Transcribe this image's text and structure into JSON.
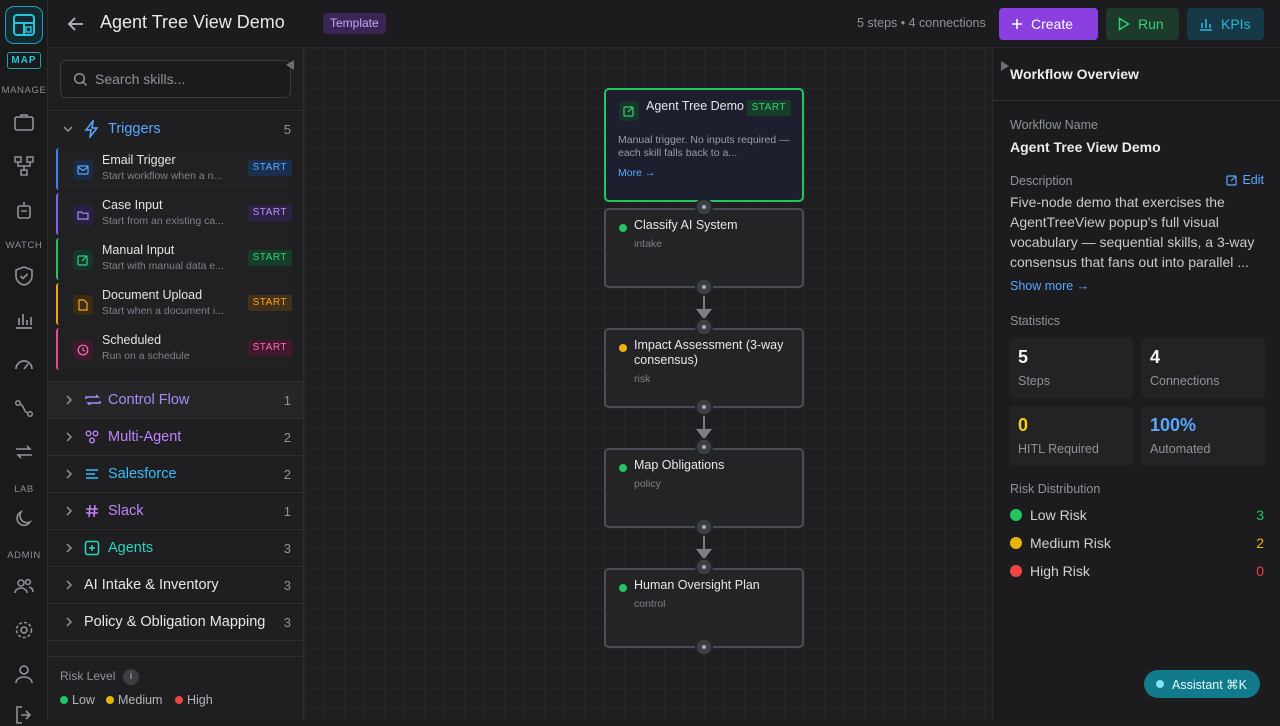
{
  "rail": {
    "badge": "MAP",
    "sections": [
      "MANAGE",
      "WATCH",
      "LAB",
      "ADMIN"
    ]
  },
  "header": {
    "title": "Agent Tree View Demo",
    "badge": "Template",
    "stats": "5 steps • 4 connections",
    "create_label": "Create",
    "run_label": "Run",
    "kpis_label": "KPIs"
  },
  "sidebar": {
    "search_placeholder": "Search skills...",
    "triggers": {
      "label": "Triggers",
      "count": "5",
      "items": [
        {
          "name": "Email Trigger",
          "desc": "Start workflow when a n...",
          "tag": "START",
          "color": "#3b82f6"
        },
        {
          "name": "Case Input",
          "desc": "Start from an existing ca...",
          "tag": "START",
          "color": "#8b5cf6"
        },
        {
          "name": "Manual Input",
          "desc": "Start with manual data e...",
          "tag": "START",
          "color": "#22c55e"
        },
        {
          "name": "Document Upload",
          "desc": "Start when a document i...",
          "tag": "START",
          "color": "#f59e0b"
        },
        {
          "name": "Scheduled",
          "desc": "Run on a schedule",
          "tag": "START",
          "color": "#ec4899"
        }
      ]
    },
    "categories": [
      {
        "label": "Control Flow",
        "count": "1",
        "color": "#a78bfa"
      },
      {
        "label": "Multi-Agent",
        "count": "2",
        "color": "#c084fc"
      },
      {
        "label": "Salesforce",
        "count": "2",
        "color": "#38bdf8"
      },
      {
        "label": "Slack",
        "count": "1",
        "color": "#c084fc"
      },
      {
        "label": "Agents",
        "count": "3",
        "color": "#2dd4bf"
      },
      {
        "label": "AI Intake & Inventory",
        "count": "3",
        "color": "#e5e7eb"
      },
      {
        "label": "Policy & Obligation Mapping",
        "count": "3",
        "color": "#e5e7eb"
      }
    ],
    "risk_level": {
      "title": "Risk Level",
      "info": "i",
      "items": [
        {
          "label": "Low",
          "color": "#22c55e"
        },
        {
          "label": "Medium",
          "color": "#eab308"
        },
        {
          "label": "High",
          "color": "#ef4444"
        }
      ]
    }
  },
  "canvas": {
    "start_node": {
      "name": "Agent Tree Demo",
      "tag": "START",
      "desc": "Manual trigger. No inputs required — each skill falls back to a...",
      "more": "More →"
    },
    "nodes": [
      {
        "name": "Classify AI System",
        "category": "intake",
        "risk_color": "#22c55e"
      },
      {
        "name": "Impact Assessment (3-way consensus)",
        "category": "risk",
        "risk_color": "#eab308"
      },
      {
        "name": "Map Obligations",
        "category": "policy",
        "risk_color": "#22c55e"
      },
      {
        "name": "Human Oversight Plan",
        "category": "control",
        "risk_color": "#22c55e"
      }
    ]
  },
  "panel": {
    "title": "Workflow Overview",
    "name_label": "Workflow Name",
    "name_value": "Agent Tree View Demo",
    "desc_label": "Description",
    "edit_label": "Edit",
    "description": "Five-node demo that exercises the AgentTreeView popup's full visual vocabulary — sequential skills, a 3-way consensus that fans out into parallel ...",
    "show_more": "Show more →",
    "stats_label": "Statistics",
    "stats": [
      {
        "value": "5",
        "label": "Steps",
        "color": "#f3f4f6"
      },
      {
        "value": "4",
        "label": "Connections",
        "color": "#f3f4f6"
      },
      {
        "value": "0",
        "label": "HITL Required",
        "color": "#facc15"
      },
      {
        "value": "100%",
        "label": "Automated",
        "color": "#5aa8ff"
      }
    ],
    "risk_label": "Risk Distribution",
    "risks": [
      {
        "label": "Low Risk",
        "count": "3",
        "color": "#22c55e"
      },
      {
        "label": "Medium Risk",
        "count": "2",
        "color": "#eab308"
      },
      {
        "label": "High Risk",
        "count": "0",
        "color": "#ef4444"
      }
    ]
  },
  "assistant": {
    "label": "Assistant ⌘K"
  }
}
